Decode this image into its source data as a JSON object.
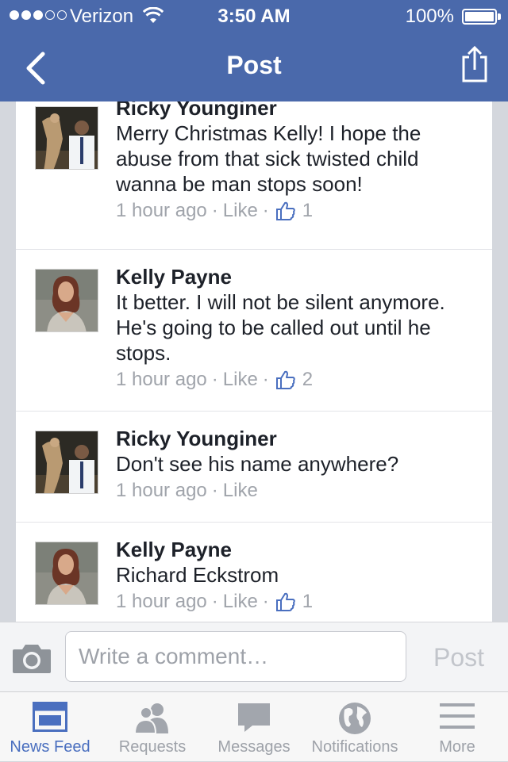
{
  "status_bar": {
    "carrier": "Verizon",
    "time": "3:50 AM",
    "battery": "100%"
  },
  "nav": {
    "title": "Post",
    "back_icon": "chevron-left-icon",
    "share_icon": "share-icon"
  },
  "comments": [
    {
      "author": "Ricky Younginer",
      "text": "Merry Christmas Kelly! I hope the abuse from that sick twisted child wanna be man stops soon!",
      "time": "1 hour ago",
      "like_label": "Like",
      "likes": "1"
    },
    {
      "author": "Kelly Payne",
      "text": "It better. I will not be silent anymore. He's going to be called out until he stops.",
      "time": "1 hour ago",
      "like_label": "Like",
      "likes": "2"
    },
    {
      "author": "Ricky Younginer",
      "text": "Don't see his name anywhere?",
      "time": "1 hour ago",
      "like_label": "Like",
      "likes": ""
    },
    {
      "author": "Kelly Payne",
      "text": "Richard Eckstrom",
      "time": "1 hour ago",
      "like_label": "Like",
      "likes": "1"
    }
  ],
  "composer": {
    "placeholder": "Write a comment…",
    "post_label": "Post"
  },
  "tabs": [
    {
      "label": "News Feed",
      "icon": "news-feed-icon",
      "active": true
    },
    {
      "label": "Requests",
      "icon": "requests-icon",
      "active": false
    },
    {
      "label": "Messages",
      "icon": "messages-icon",
      "active": false
    },
    {
      "label": "Notifications",
      "icon": "notifications-icon",
      "active": false
    },
    {
      "label": "More",
      "icon": "more-icon",
      "active": false
    }
  ],
  "colors": {
    "brand": "#4a69ab",
    "active_tab": "#4a6fbf",
    "meta_text": "#a0a4ab"
  }
}
